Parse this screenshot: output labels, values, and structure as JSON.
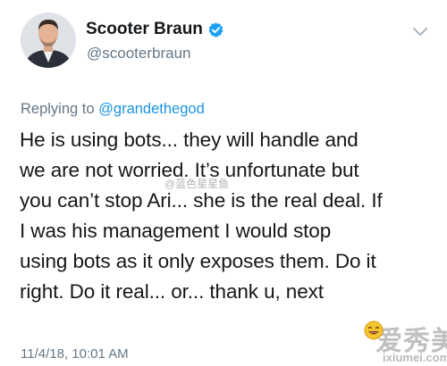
{
  "author": {
    "display_name": "Scooter Braun",
    "handle": "@scooterbraun",
    "verified": true,
    "avatar_icon": "profile-photo"
  },
  "reply": {
    "prefix": "Replying to",
    "mention": "@grandethegod"
  },
  "body": {
    "lines": [
      "He is using bots... they will handle and",
      "we are not worried. It’s unfortunate but",
      "you can’t stop Ari... she is the real deal. If",
      "I was his management I would stop",
      "using bots as it only exposes them. Do it",
      "right. Do it real... or... thank u, next"
    ]
  },
  "timestamp": "11/4/18, 10:01 AM",
  "watermarks": {
    "center": "@蓝色星星鱼",
    "logo_main": "爱秀美",
    "logo_sub": "ixiumei.com"
  },
  "colors": {
    "text": "#14171a",
    "secondary": "#657786",
    "link": "#1b95e0",
    "verified": "#1da1f2"
  },
  "icons": {
    "verified": "verified-badge-icon",
    "menu": "chevron-down-icon",
    "emoji": "laughing-emoji-icon"
  }
}
